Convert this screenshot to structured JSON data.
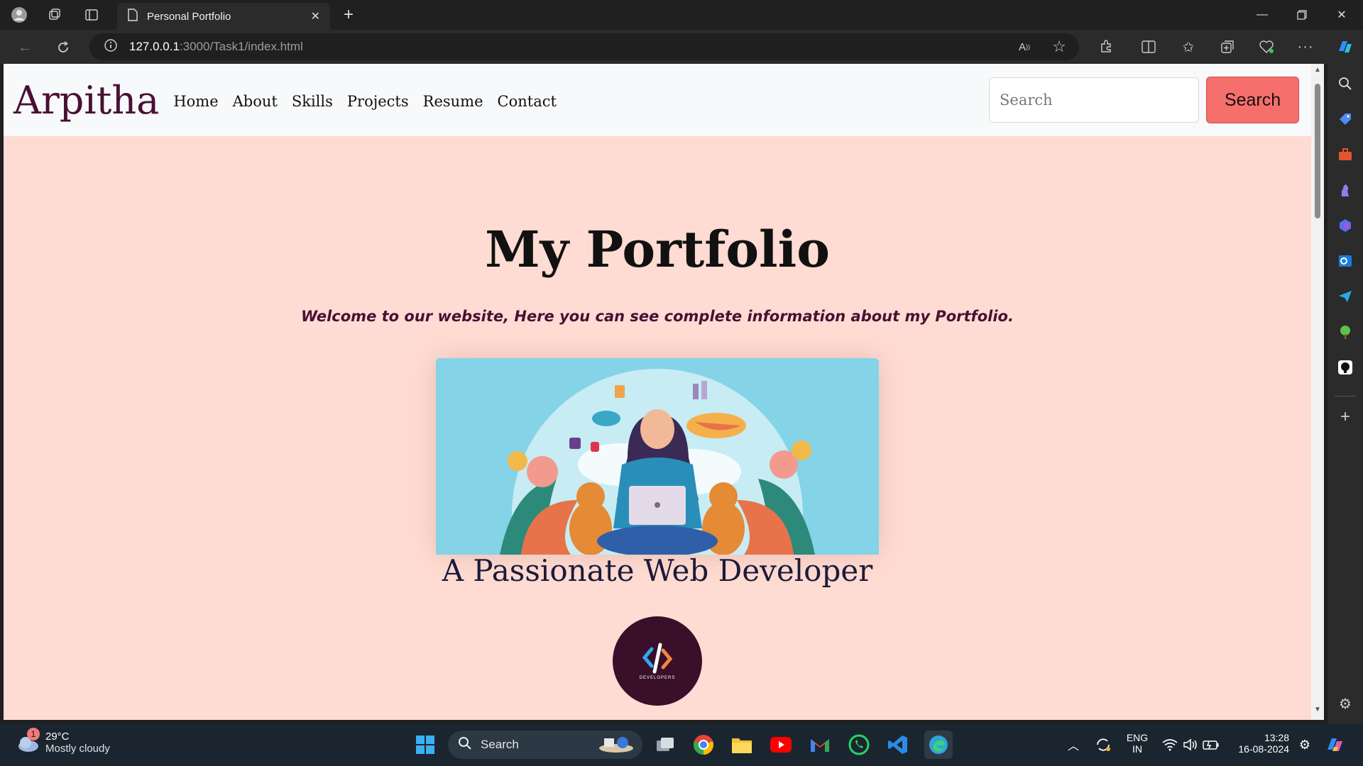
{
  "browser": {
    "tab_title": "Personal Portfolio",
    "url_host": "127.0.0.1",
    "url_path": ":3000/Task1/index.html"
  },
  "site": {
    "brand": "Arpitha",
    "nav": [
      "Home",
      "About",
      "Skills",
      "Projects",
      "Resume",
      "Contact"
    ],
    "search_placeholder": "Search",
    "search_button": "Search",
    "hero_title": "My Portfolio",
    "welcome": "Welcome to our website, Here you can see complete information about my Portfolio.",
    "tagline": "A Passionate Web Developer",
    "logo_text": "DEVELOPERS"
  },
  "taskbar": {
    "weather_badge": "1",
    "temperature": "29°C",
    "condition": "Mostly cloudy",
    "search_label": "Search",
    "lang_top": "ENG",
    "lang_bottom": "IN",
    "time": "13:28",
    "date": "16-08-2024"
  },
  "colors": {
    "page_bg": "#ffdcd3",
    "brand": "#4a1034",
    "search_button": "#f5706d",
    "navbar_bg": "#f8f9fa"
  }
}
